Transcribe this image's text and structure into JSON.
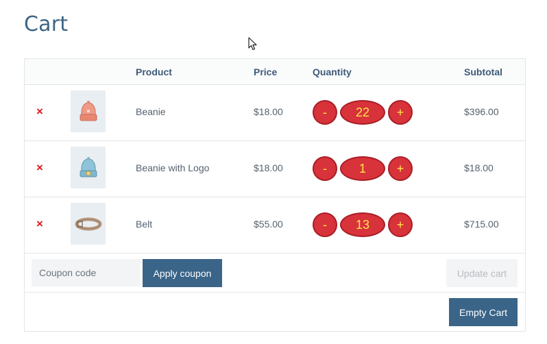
{
  "page": {
    "title": "Cart"
  },
  "table": {
    "headers": {
      "product": "Product",
      "price": "Price",
      "quantity": "Quantity",
      "subtotal": "Subtotal"
    },
    "rows": [
      {
        "name": "Beanie",
        "price": "$18.00",
        "quantity": "22",
        "subtotal": "$396.00",
        "image_icon": "beanie-icon",
        "image_color": "#ee9a87"
      },
      {
        "name": "Beanie with Logo",
        "price": "$18.00",
        "quantity": "1",
        "subtotal": "$18.00",
        "image_icon": "beanie-logo-icon",
        "image_color": "#8fc3d9"
      },
      {
        "name": "Belt",
        "price": "$55.00",
        "quantity": "13",
        "subtotal": "$715.00",
        "image_icon": "belt-icon",
        "image_color": "#b89a80"
      }
    ],
    "remove_symbol": "×",
    "minus_label": "-",
    "plus_label": "+"
  },
  "actions": {
    "coupon_placeholder": "Coupon code",
    "apply_coupon": "Apply coupon",
    "update_cart": "Update cart",
    "empty_cart": "Empty Cart"
  },
  "colors": {
    "title": "#3d6486",
    "primary_button": "#3a6488",
    "remove": "#e2161c",
    "qty_fill": "#d8323a",
    "qty_text": "#ffe64a"
  }
}
